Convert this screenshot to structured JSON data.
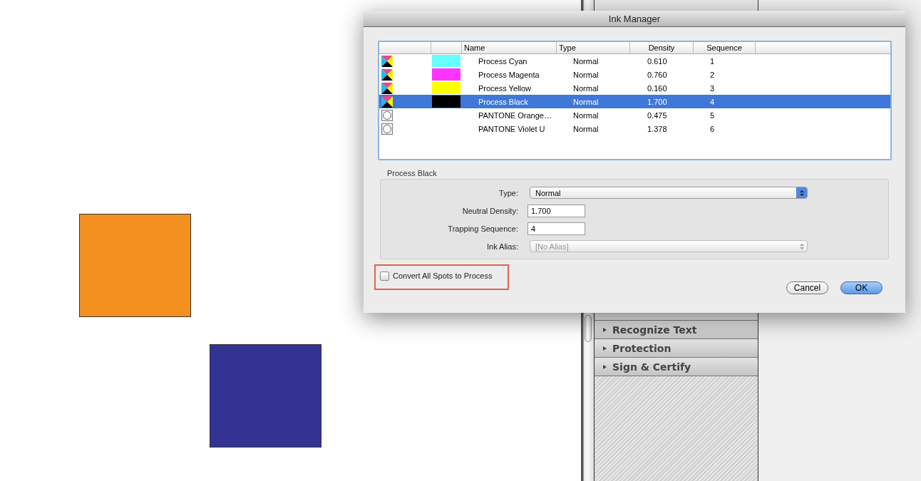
{
  "panel": {
    "sections": [
      {
        "label": "Recognize Text",
        "expanded": false
      },
      {
        "label": "Protection",
        "expanded": false
      },
      {
        "label": "Sign & Certify",
        "expanded": false
      }
    ]
  },
  "dialog": {
    "title": "Ink Manager",
    "table": {
      "columns": [
        "Name",
        "Type",
        "Density",
        "Sequence"
      ],
      "rows": [
        {
          "kind": "process",
          "color": "#66ffff",
          "name": "Process Cyan",
          "type": "Normal",
          "density": "0.610",
          "sequence": "1",
          "selected": false
        },
        {
          "kind": "process",
          "color": "#ff33ff",
          "name": "Process Magenta",
          "type": "Normal",
          "density": "0.760",
          "sequence": "2",
          "selected": false
        },
        {
          "kind": "process",
          "color": "#ffff00",
          "name": "Process Yellow",
          "type": "Normal",
          "density": "0.160",
          "sequence": "3",
          "selected": false
        },
        {
          "kind": "process",
          "color": "#000000",
          "name": "Process Black",
          "type": "Normal",
          "density": "1.700",
          "sequence": "4",
          "selected": true
        },
        {
          "kind": "spot",
          "name": "PANTONE Orange…",
          "type": "Normal",
          "density": "0.475",
          "sequence": "5",
          "selected": false
        },
        {
          "kind": "spot",
          "name": "PANTONE Violet U",
          "type": "Normal",
          "density": "1.378",
          "sequence": "6",
          "selected": false
        }
      ]
    },
    "details": {
      "title": "Process Black",
      "fields": [
        {
          "kind": "select",
          "label": "Type:",
          "value": "Normal",
          "disabled": false
        },
        {
          "kind": "input",
          "label": "Neutral Density:",
          "value": "1.700"
        },
        {
          "kind": "input",
          "label": "Trapping Sequence:",
          "value": "4"
        },
        {
          "kind": "select",
          "label": "Ink Alias:",
          "value": "[No Alias]",
          "disabled": true
        }
      ]
    },
    "convert_checkbox": {
      "label": "Convert All Spots to Process",
      "checked": false,
      "highlighted": true
    },
    "buttons": [
      {
        "label": "Cancel",
        "default": false
      },
      {
        "label": "OK",
        "default": true
      }
    ]
  }
}
